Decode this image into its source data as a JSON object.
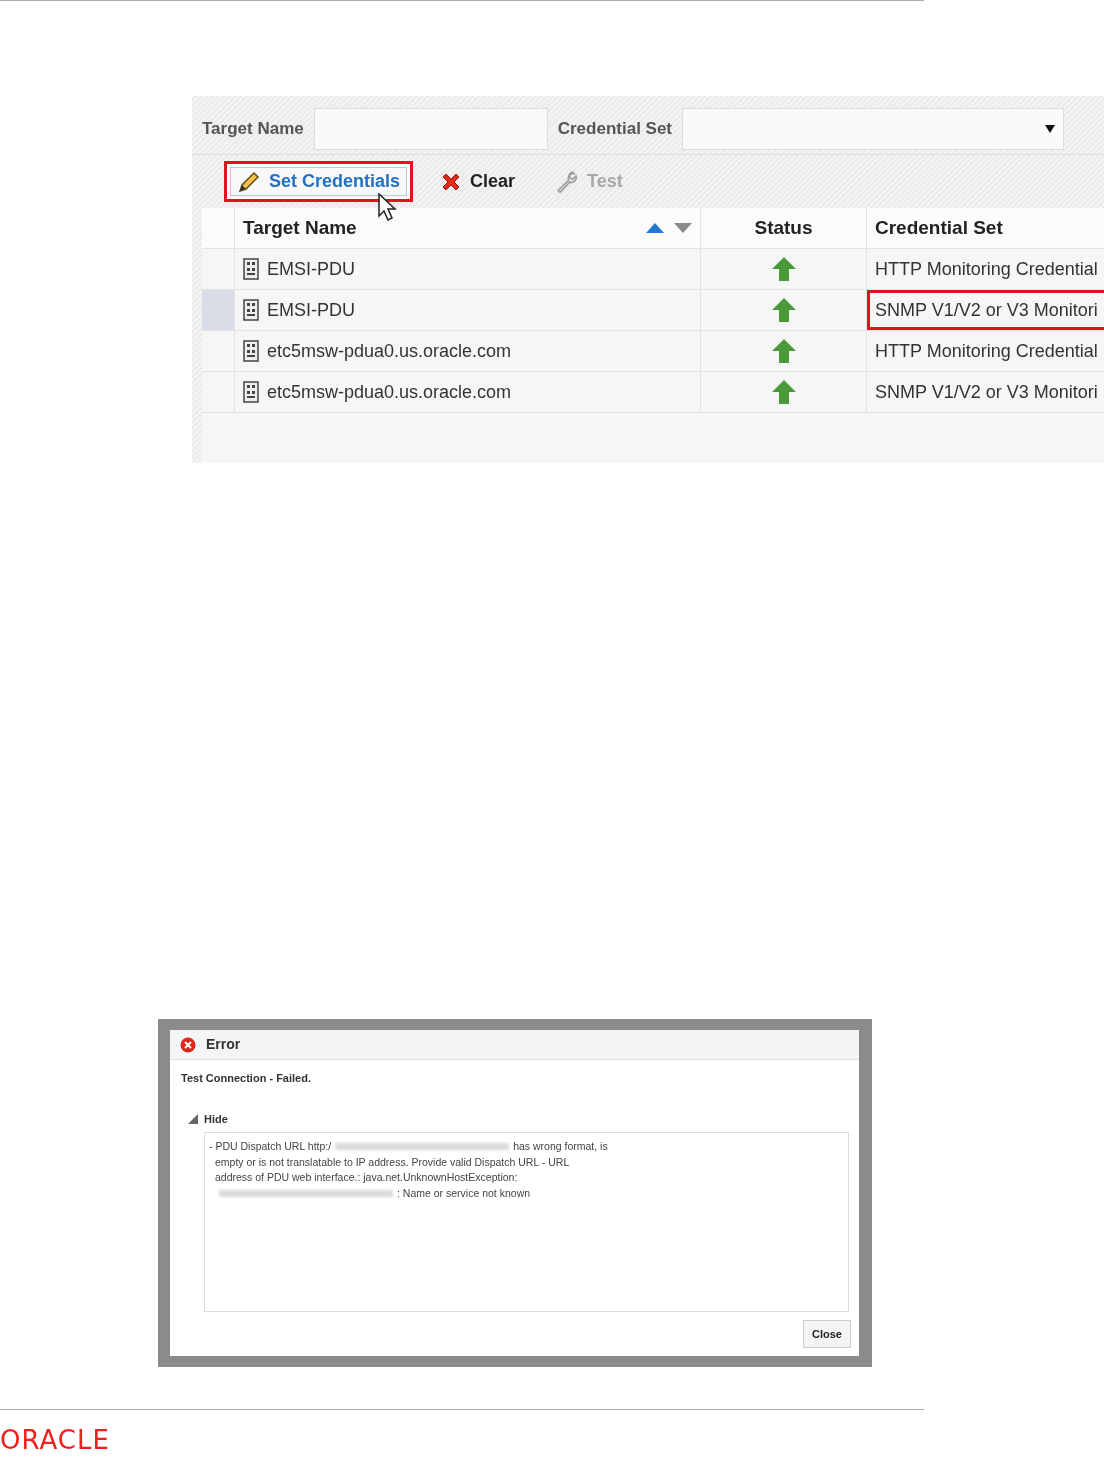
{
  "credentials_screen": {
    "filters": [
      {
        "label": "Target Name",
        "kind": "text"
      },
      {
        "label": "Credential Set",
        "kind": "select"
      }
    ],
    "toolbar": [
      {
        "label": "Set Credentials",
        "kind": "pencil",
        "disabled": false,
        "highlighted": true
      },
      {
        "label": "Clear",
        "kind": "clear",
        "disabled": false,
        "highlighted": false
      },
      {
        "label": "Test",
        "kind": "wrench",
        "disabled": true,
        "highlighted": false
      }
    ],
    "columns": [
      {
        "label": "Target Name",
        "sortable": true
      },
      {
        "label": "Status",
        "sortable": false
      },
      {
        "label": "Credential Set",
        "sortable": false
      }
    ],
    "rows": [
      {
        "target": "EMSI-PDU",
        "credential_set": "HTTP Monitoring Credential",
        "selected": false,
        "highlighted": false
      },
      {
        "target": "EMSI-PDU",
        "credential_set": "SNMP V1/V2 or V3 Monitori",
        "selected": true,
        "highlighted": true
      },
      {
        "target": "etc5msw-pdua0.us.oracle.com",
        "credential_set": "HTTP Monitoring Credential",
        "selected": false,
        "highlighted": false
      },
      {
        "target": "etc5msw-pdua0.us.oracle.com",
        "credential_set": "SNMP V1/V2 or V3 Monitori",
        "selected": false,
        "highlighted": false
      }
    ]
  },
  "error_dialog": {
    "title": "Error",
    "summary": "Test Connection - Failed.",
    "details_toggle": {
      "label": "Hide",
      "expanded": true
    },
    "message_lines": [
      [
        {
          "kind": "text",
          "text": "- PDU Dispatch URL http:/"
        },
        {
          "kind": "redacted"
        },
        {
          "kind": "text",
          "text": "has wrong format, is"
        }
      ],
      [
        {
          "kind": "text",
          "text": "empty or is not translatable to IP address. Provide valid Dispatch URL - URL"
        }
      ],
      [
        {
          "kind": "text",
          "text": "address of PDU web interface.: java.net.UnknownHostException:"
        }
      ],
      [
        {
          "kind": "redacted"
        },
        {
          "kind": "text",
          "text": ": Name or service not known"
        }
      ]
    ],
    "buttons": [
      "Close"
    ]
  },
  "footer": {
    "logo": "ORACLE"
  }
}
